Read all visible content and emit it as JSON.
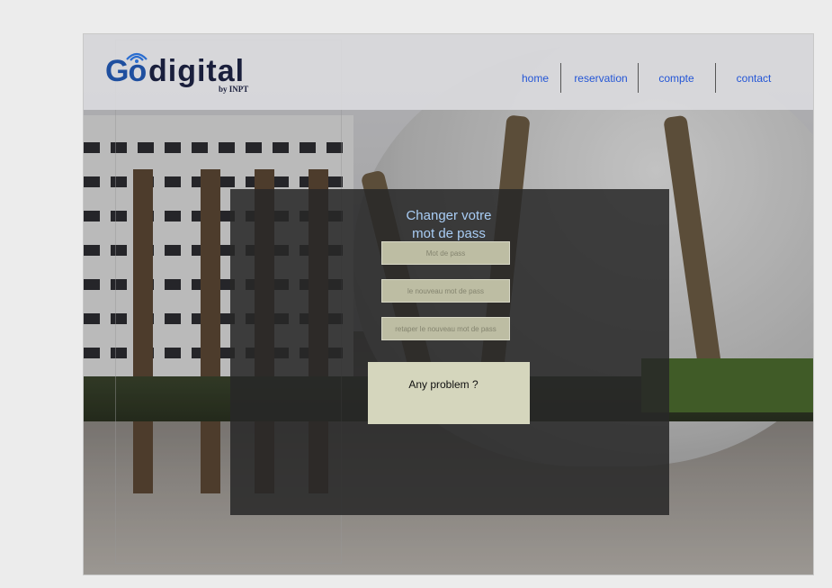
{
  "header": {
    "logo": {
      "go": "Go",
      "digital": "digital",
      "by": "by INPT"
    },
    "nav": [
      {
        "label": "home"
      },
      {
        "label": "reservation"
      },
      {
        "label": "compte"
      },
      {
        "label": "contact"
      }
    ]
  },
  "form": {
    "title_line1": "Changer votre",
    "title_line2": "mot de pass",
    "fields": [
      {
        "placeholder": "Mot de pass"
      },
      {
        "placeholder": "le nouveau mot de pass"
      },
      {
        "placeholder": "retaper le nouveau mot de pass"
      }
    ],
    "problem_label": "Any problem ?"
  },
  "colors": {
    "nav_link": "#2456d6",
    "title": "#a9cdf5",
    "logo_blue": "#1f4f9f",
    "logo_dark": "#1a1f3c"
  }
}
